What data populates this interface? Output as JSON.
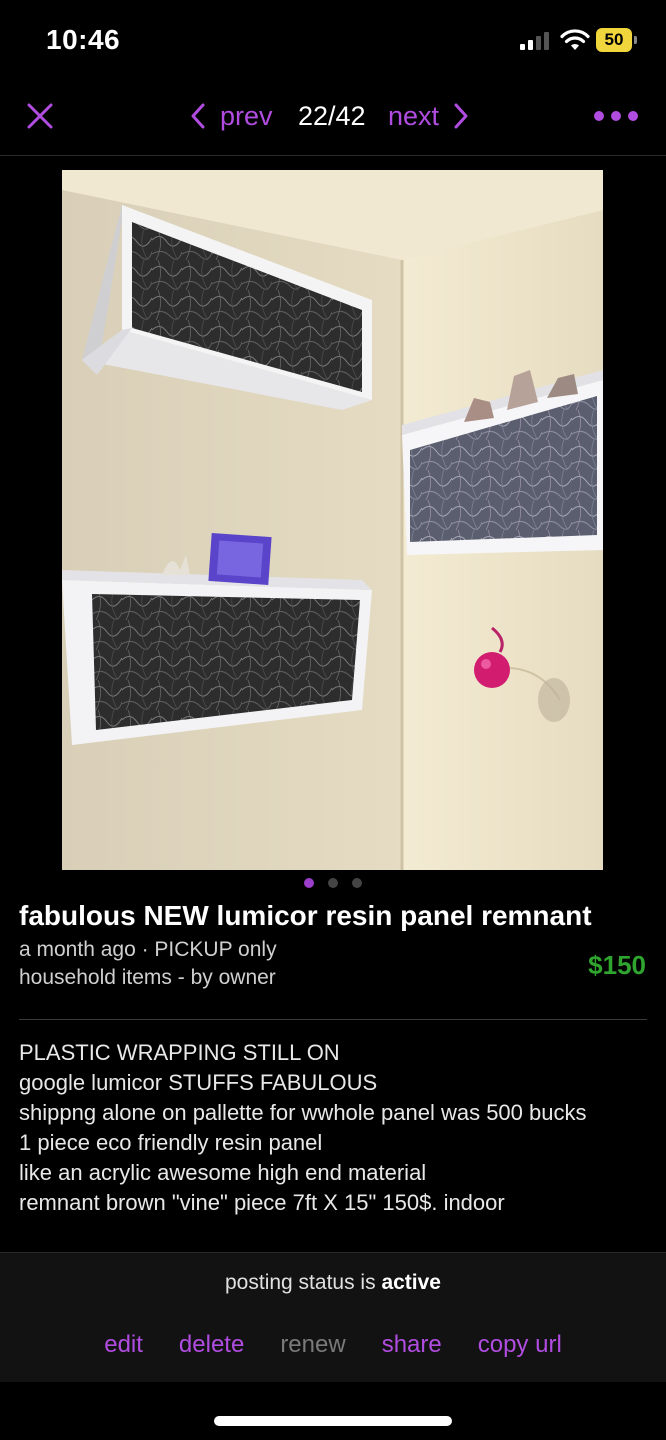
{
  "status_bar": {
    "time": "10:46",
    "battery": "50"
  },
  "nav": {
    "prev_label": "prev",
    "counter": "22/42",
    "next_label": "next",
    "accent_color": "#b04de0"
  },
  "gallery": {
    "total_images": 3,
    "active_index": 0
  },
  "listing": {
    "title": "fabulous NEW lumicor resin panel remnant",
    "meta_line1": "a month ago · PICKUP only",
    "meta_line2": "household items - by owner",
    "price": "$150",
    "price_color": "#2fa52f",
    "description_lines": [
      "PLASTIC WRAPPING STILL ON",
      "google lumicor STUFFS FABULOUS",
      "shippng alone on pallette for wwhole panel was 500 bucks",
      "1 piece eco friendly resin panel",
      "like an acrylic awesome high end material",
      "remnant brown \"vine\" piece 7ft X 15\" 150$. indoor"
    ]
  },
  "footer": {
    "status_prefix": "posting status is",
    "status_value": "active",
    "actions": {
      "edit": "edit",
      "delete": "delete",
      "renew": "renew",
      "share": "share",
      "copy_url": "copy url"
    }
  }
}
